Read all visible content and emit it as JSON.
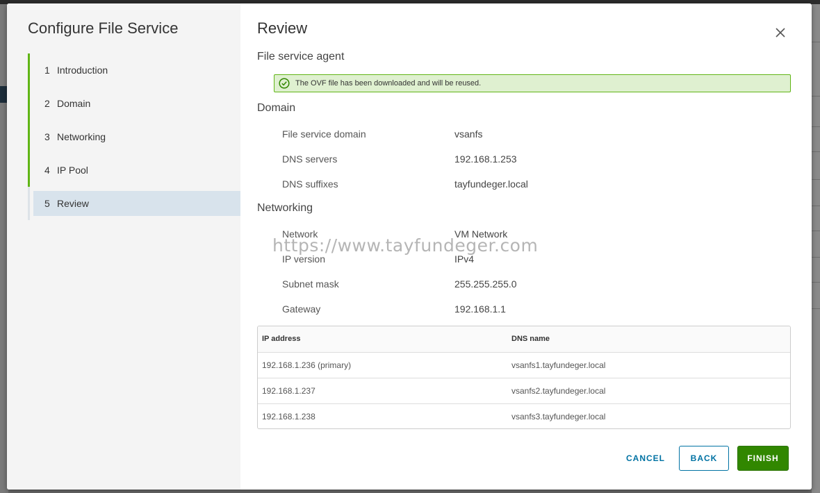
{
  "wizard": {
    "title": "Configure File Service",
    "steps": [
      {
        "num": "1",
        "label": "Introduction"
      },
      {
        "num": "2",
        "label": "Domain"
      },
      {
        "num": "3",
        "label": "Networking"
      },
      {
        "num": "4",
        "label": "IP Pool"
      },
      {
        "num": "5",
        "label": "Review"
      }
    ],
    "active_step": 5
  },
  "review": {
    "title": "Review",
    "agent_section": "File service agent",
    "alert_text": "The OVF file has been downloaded and will be reused.",
    "alert_icon": "check-circle-icon",
    "domain_section": "Domain",
    "domain": [
      {
        "key": "File service domain",
        "value": "vsanfs"
      },
      {
        "key": "DNS servers",
        "value": "192.168.1.253"
      },
      {
        "key": "DNS suffixes",
        "value": "tayfundeger.local"
      }
    ],
    "networking_section": "Networking",
    "networking": [
      {
        "key": "Network",
        "value": "VM Network"
      },
      {
        "key": "IP version",
        "value": "IPv4"
      },
      {
        "key": "Subnet mask",
        "value": "255.255.255.0"
      },
      {
        "key": "Gateway",
        "value": "192.168.1.1"
      }
    ],
    "table": {
      "headers": [
        "IP address",
        "DNS name"
      ],
      "rows": [
        [
          "192.168.1.236 (primary)",
          "vsanfs1.tayfundeger.local"
        ],
        [
          "192.168.1.237",
          "vsanfs2.tayfundeger.local"
        ],
        [
          "192.168.1.238",
          "vsanfs3.tayfundeger.local"
        ]
      ]
    }
  },
  "watermark": "https://www.tayfundeger.com",
  "buttons": {
    "cancel": "CANCEL",
    "back": "BACK",
    "finish": "FINISH"
  },
  "colors": {
    "accent": "#0072a3",
    "progress_green": "#60b515",
    "finish_green": "#318700",
    "alert_bg": "#dff0d0"
  }
}
